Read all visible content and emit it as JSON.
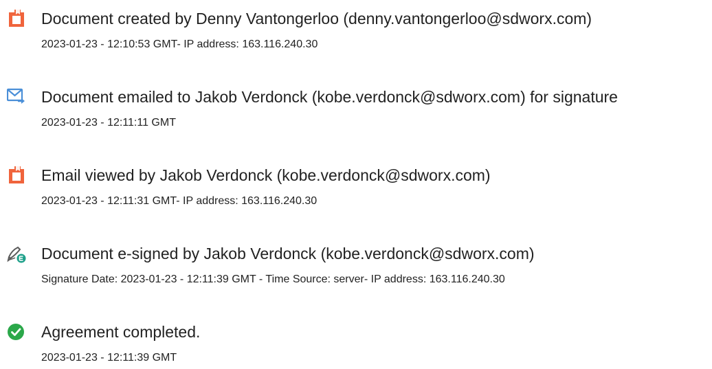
{
  "colors": {
    "doc_orange": "#F0643C",
    "mail_blue": "#4A8FD8",
    "esign_gray": "#5A5A5A",
    "esign_teal": "#1EA08A",
    "complete_green": "#2BA84A"
  },
  "events": [
    {
      "icon": "document-created-icon",
      "title": "Document created by Denny Vantongerloo (denny.vantongerloo@sdworx.com)",
      "detail": "2023-01-23 - 12:10:53 GMT- IP address: 163.116.240.30"
    },
    {
      "icon": "email-sent-icon",
      "title": "Document emailed to Jakob Verdonck (kobe.verdonck@sdworx.com) for signature",
      "detail": "2023-01-23 - 12:11:11 GMT"
    },
    {
      "icon": "document-viewed-icon",
      "title": "Email viewed by Jakob Verdonck (kobe.verdonck@sdworx.com)",
      "detail": "2023-01-23 - 12:11:31 GMT- IP address: 163.116.240.30"
    },
    {
      "icon": "esign-pen-icon",
      "title": "Document e-signed by Jakob Verdonck (kobe.verdonck@sdworx.com)",
      "detail": "Signature Date: 2023-01-23 - 12:11:39 GMT - Time Source: server- IP address: 163.116.240.30"
    },
    {
      "icon": "checkmark-circle-icon",
      "title": "Agreement completed.",
      "detail": "2023-01-23 - 12:11:39 GMT"
    }
  ]
}
